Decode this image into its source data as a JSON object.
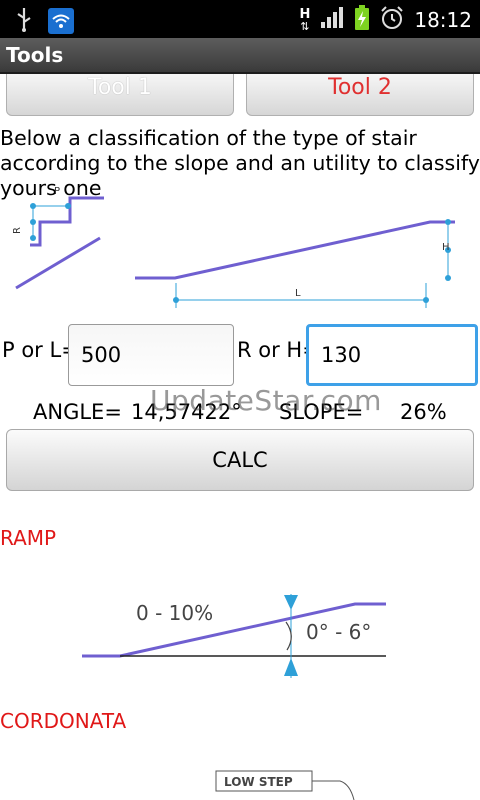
{
  "status_bar": {
    "time": "18:12",
    "network_label": "H"
  },
  "title": "Tools",
  "tabs": [
    {
      "label": "Tool 1"
    },
    {
      "label": "Tool 2"
    }
  ],
  "description": "Below a classification of the type of stair according to the slope and an utility to classify yours one",
  "diagram": {
    "stair_p": "P",
    "stair_r": "R",
    "ramp_h": "H",
    "ramp_l": "L"
  },
  "inputs": {
    "p_or_l": {
      "label": "P or L=",
      "value": "500"
    },
    "r_or_h": {
      "label": "R or H=",
      "value": "130"
    }
  },
  "result": {
    "angle_label": "ANGLE=",
    "angle_value": "14,57422°",
    "slope_label": "SLOPE=",
    "slope_value": "26%"
  },
  "calc_button": "CALC",
  "watermark": "UpdateStar.com",
  "sections": {
    "ramp": {
      "title": "RAMP",
      "slope_range": "0 - 10%",
      "angle_range": "0° - 6°"
    },
    "cordonata": {
      "title": "CORDONATA",
      "low_step": "LOW STEP"
    }
  },
  "colors": {
    "accent": "#3ea1e8",
    "section": "#e01818",
    "diagram": "#6f5fd0",
    "cyan": "#2ea0d8"
  }
}
